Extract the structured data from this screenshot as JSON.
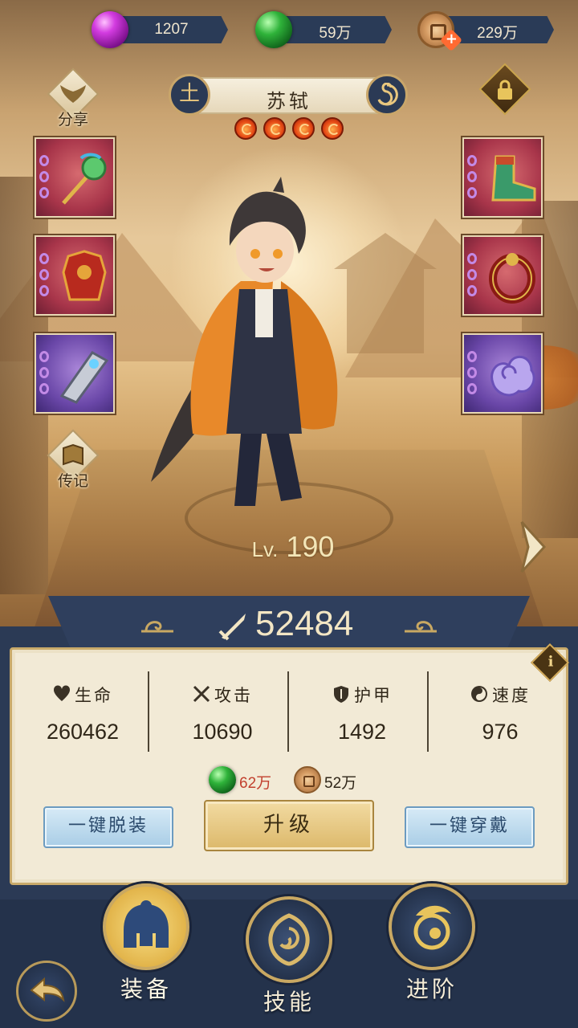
{
  "resources": [
    {
      "icon": "purple-gem-icon",
      "value": "1207"
    },
    {
      "icon": "green-jade-icon",
      "value": "59万"
    },
    {
      "icon": "copper-coin-icon",
      "value": "229万"
    }
  ],
  "side_badges": {
    "share": "分享",
    "biography": "传记"
  },
  "hero": {
    "name": "苏轼",
    "element_left": "土",
    "stars": 4,
    "level_prefix": "Lv.",
    "level": "190"
  },
  "power": "52484",
  "stats": [
    {
      "label": "生命",
      "icon": "heart-icon",
      "value": "260462"
    },
    {
      "label": "攻击",
      "icon": "crossed-swords-icon",
      "value": "10690"
    },
    {
      "label": "护甲",
      "icon": "shield-icon",
      "value": "1492"
    },
    {
      "label": "速度",
      "icon": "swirl-icon",
      "value": "976"
    }
  ],
  "upgrade_cost": [
    {
      "icon": "green-jade-icon",
      "value": "62万",
      "color": "#c2402e"
    },
    {
      "icon": "copper-coin-icon",
      "value": "52万",
      "color": "#2f2618"
    }
  ],
  "buttons": {
    "unequip_all": "一键脱装",
    "upgrade": "升级",
    "equip_all": "一键穿戴"
  },
  "nav": {
    "equipment": "装备",
    "skills": "技能",
    "advance": "进阶"
  },
  "colors": {
    "panel_navy": "#2b3a55",
    "gold": "#c9a862",
    "cost_insufficient": "#c2402e"
  }
}
